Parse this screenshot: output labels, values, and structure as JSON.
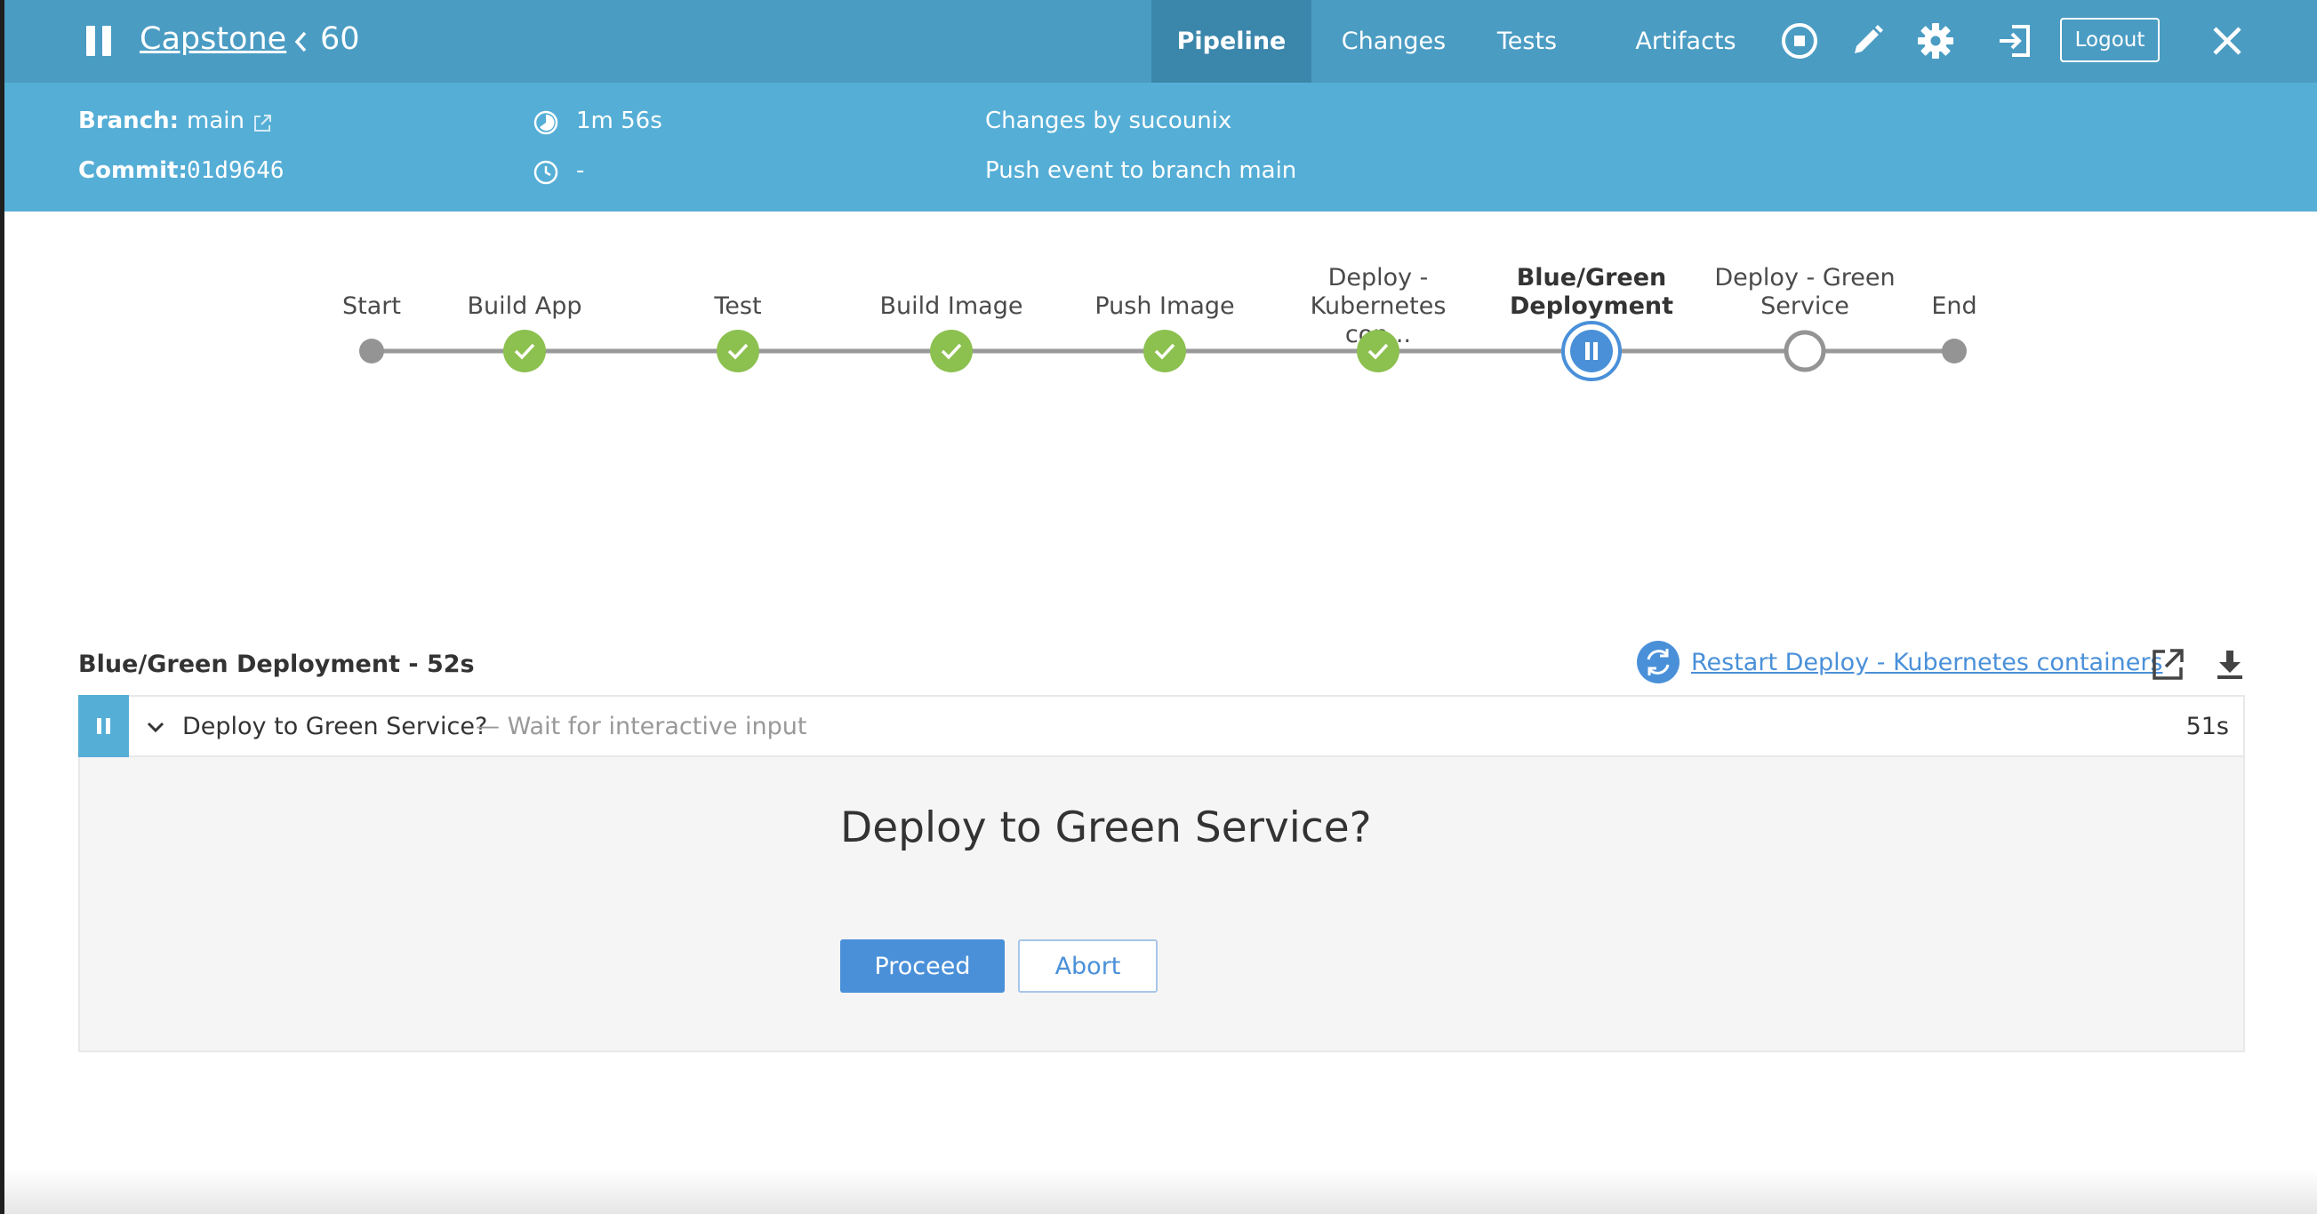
{
  "header": {
    "title": "Capstone",
    "run_number": "60",
    "tabs": [
      {
        "label": "Pipeline",
        "active": true
      },
      {
        "label": "Changes",
        "active": false
      },
      {
        "label": "Tests",
        "active": false
      },
      {
        "label": "Artifacts",
        "active": false
      }
    ],
    "icons": [
      "stop-icon",
      "edit-icon",
      "gear-icon",
      "exit-icon"
    ],
    "logout_label": "Logout",
    "close_icon": "close-icon"
  },
  "run_info": {
    "branch_label": "Branch:",
    "branch_value": "main",
    "commit_label": "Commit:",
    "commit_value": "01d9646",
    "duration": "1m 56s",
    "started": "-",
    "changes_text": "Changes by sucounix",
    "cause_text": "Push event to branch main"
  },
  "pipeline": {
    "stages": [
      {
        "label": "Start",
        "status": "start"
      },
      {
        "label": "Build App",
        "status": "success"
      },
      {
        "label": "Test",
        "status": "success"
      },
      {
        "label": "Build Image",
        "status": "success"
      },
      {
        "label": "Push Image",
        "status": "success"
      },
      {
        "label_line1": "Deploy -",
        "label_line2": "Kubernetes con...",
        "status": "success"
      },
      {
        "label_line1": "Blue/Green",
        "label_line2": "Deployment",
        "status": "paused"
      },
      {
        "label_line1": "Deploy - Green",
        "label_line2": "Service",
        "status": "not-built"
      },
      {
        "label": "End",
        "status": "end"
      }
    ]
  },
  "stage_detail": {
    "title": "Blue/Green Deployment - 52s",
    "restart_label": "Restart Deploy - Kubernetes containers",
    "step": {
      "name": "Deploy to Green Service?",
      "description": "— Wait for interactive input",
      "duration": "51s"
    },
    "input": {
      "message": "Deploy to Green Service?",
      "proceed_label": "Proceed",
      "abort_label": "Abort"
    }
  },
  "colors": {
    "topbar": "#4a9cc3",
    "subbar": "#55aed6",
    "success": "#8cc04f",
    "paused": "#4a90d9",
    "link": "#4a90d9"
  }
}
